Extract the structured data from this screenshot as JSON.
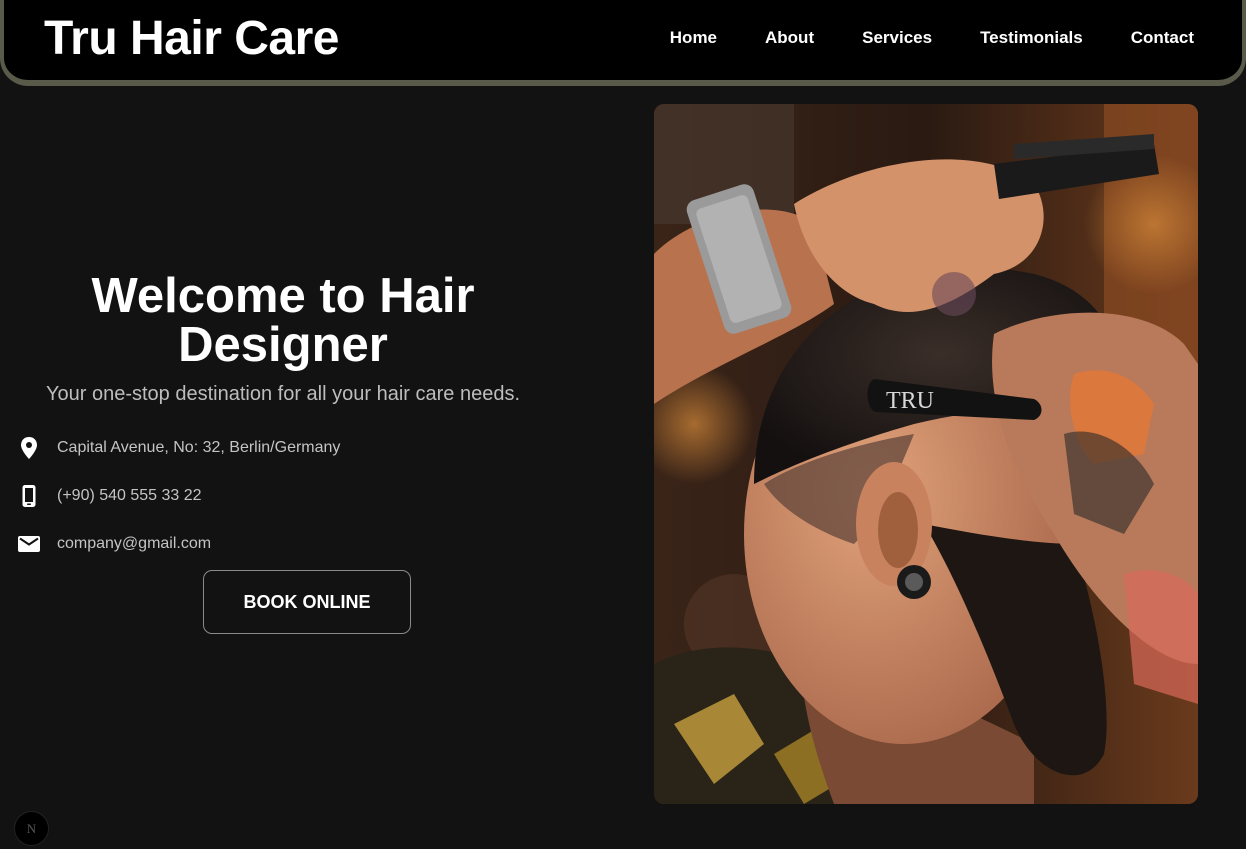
{
  "header": {
    "brand": "Tru Hair Care",
    "nav": [
      "Home",
      "About",
      "Services",
      "Testimonials",
      "Contact"
    ]
  },
  "hero": {
    "title": "Welcome to Hair Designer",
    "subtitle": "Your one-stop destination for all your hair care needs.",
    "contacts": [
      {
        "icon": "location-pin-icon",
        "text": "Capital Avenue, No: 32, Berlin/Germany"
      },
      {
        "icon": "phone-icon",
        "text": "(+90) 540 555 33 22"
      },
      {
        "icon": "mail-icon",
        "text": "company@gmail.com"
      }
    ],
    "cta": "BOOK ONLINE"
  },
  "photo": {
    "razor_text": "TRU"
  },
  "badge": {
    "letter": "N"
  }
}
